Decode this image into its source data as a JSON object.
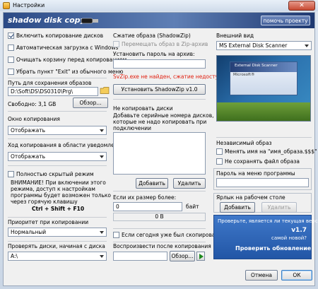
{
  "window": {
    "title": "Настройки",
    "close_glyph": "✕"
  },
  "banner": {
    "logo_text": "shadow disk copy",
    "help_button": "помочь проекту"
  },
  "left": {
    "checkboxes": [
      {
        "label": "Включить копирование дисков",
        "checked": true
      },
      {
        "label": "Автоматическая загрузка с Windows",
        "checked": false
      },
      {
        "label": "Очищать корзину перед копированием",
        "checked": false
      },
      {
        "label": "Убрать пункт \"Exit\" из обычного меню",
        "checked": false
      }
    ],
    "save_path_label": "Путь для сохранения образов",
    "save_path_value": "D:\\Soft\\DS\\DS0310\\Prg\\",
    "free_label": "Свободно: 3,1 GB",
    "browse_button": "Обзор...",
    "copy_window_label": "Окно копирования",
    "copy_window_value": "Отображать",
    "notify_label": "Ход копирования в области уведомлений",
    "notify_value": "Отображать",
    "hidden_mode_label": "Полностью скрытый режим",
    "hidden_mode_checked": false,
    "warning_text_1": "ВНИМАНИЕ! При включении этого",
    "warning_text_2": "режима, доступ к настройкам",
    "warning_text_3": "программы будет возможен только",
    "warning_text_4": "через горячую клавишу",
    "hotkey": "Ctrl + Shift + F10",
    "priority_label": "Приоритет при копировании",
    "priority_value": "Нормальный",
    "check_disks_label": "Проверять диски, начиная с диска",
    "check_disks_value": "A:\\"
  },
  "middle": {
    "compression_label": "Сжатие образа (ShadowZip)",
    "move_zip_label": "Перемещать образ в Zip-архив",
    "password_label": "Установить пароль на архив:",
    "password_value": "",
    "error_text": "SvZip.exe не найден, сжатие недоступно!",
    "install_button": "Установить ShadowZip v1.0",
    "no_copy_label": "Не копировать диски",
    "no_copy_desc_1": "Добавьте серийные номера дисков,",
    "no_copy_desc_2": "которые не надо копировать при",
    "no_copy_desc_3": "подключении",
    "add_button": "Добавить",
    "delete_button": "Удалить",
    "size_label": "Если их размер более:",
    "size_value": "0",
    "size_unit": "байт",
    "size_bytes": "0 B",
    "today_copied_label": "Если сегодня уже был скопирован",
    "today_copied_checked": false,
    "play_label": "Воспроизвести после копирования",
    "play_browse_button": "Обзор...",
    "play_value": ""
  },
  "right": {
    "appearance_label": "Внешний вид",
    "skin_value": "MS External Disk Scanner",
    "preview_title": "External Disk Scanner",
    "preview_sub": "Microsoft®",
    "independent_label": "Независимый образ",
    "rename_label": "Менять имя на \"имя_образа.$$$\"",
    "rename_checked": false,
    "no_save_label": "Не сохранять файл образа",
    "no_save_checked": false,
    "menu_password_label": "Пароль на меню программы",
    "menu_password_value": "",
    "desktop_shortcut_label": "Ярлык на рабочем столе",
    "shortcut_add_button": "Добавить",
    "shortcut_delete_button": "Удалить",
    "promo_line1": "Проверьте, является ли текущая версия",
    "promo_version": "v1.7",
    "promo_line2": "самой новой?",
    "promo_link": "Проверить обновление"
  },
  "footer": {
    "cancel_button": "Отмена",
    "ok_button": "ОК"
  }
}
